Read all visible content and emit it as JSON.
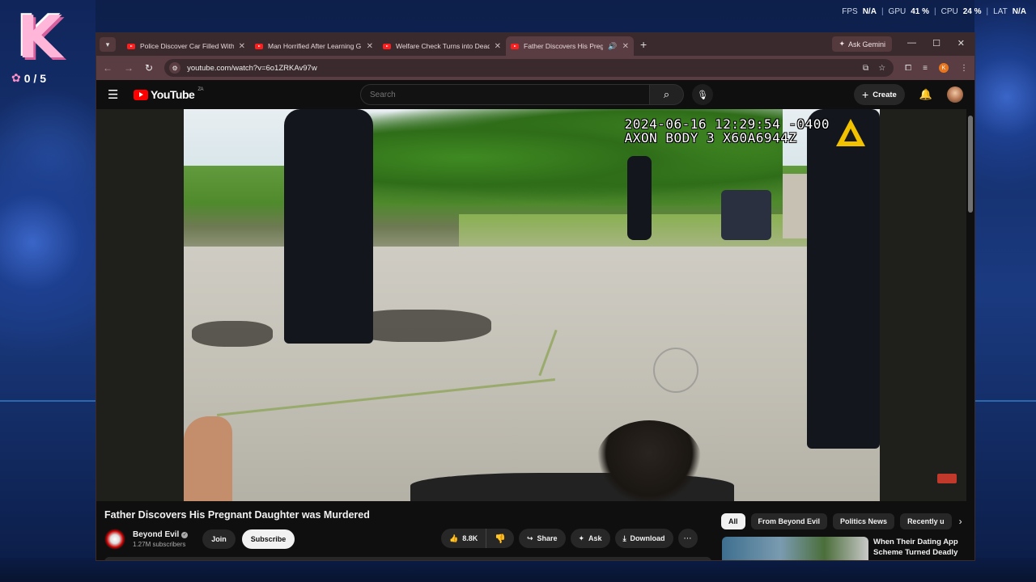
{
  "overlay": {
    "k_logo": "K",
    "counter": "0 / 5",
    "stats": {
      "fps_label": "FPS",
      "fps_value": "N/A",
      "gpu_label": "GPU",
      "gpu_value": "41 %",
      "cpu_label": "CPU",
      "cpu_value": "24 %",
      "lat_label": "LAT",
      "lat_value": "N/A"
    }
  },
  "browser": {
    "tabs": [
      {
        "title": "Police Discover Car Filled With"
      },
      {
        "title": "Man Horrified After Learning G"
      },
      {
        "title": "Welfare Check Turns into Dead"
      },
      {
        "title": "Father Discovers His Pregna"
      }
    ],
    "ask_gemini": "Ask Gemini",
    "url": "youtube.com/watch?v=6o1ZRKAv97w",
    "profile_initial": "K"
  },
  "youtube": {
    "logo_text": "YouTube",
    "region": "ZA",
    "search_placeholder": "Search",
    "create_label": "Create",
    "video": {
      "overlay_line1": "2024-06-16 12:29:54 -0400",
      "overlay_line2": "AXON BODY 3 X60A6944Z",
      "title": "Father Discovers His Pregnant Daughter was Murdered"
    },
    "channel": {
      "name": "Beyond Evil",
      "subscribers": "1.27M subscribers",
      "join_label": "Join",
      "subscribe_label": "Subscribe"
    },
    "actions": {
      "likes": "8.8K",
      "share": "Share",
      "ask": "Ask",
      "download": "Download"
    },
    "chips": [
      "All",
      "From Beyond Evil",
      "Politics News",
      "Recently u"
    ],
    "recommendation": {
      "title": "When Their Dating App Scheme Turned Deadly"
    }
  }
}
